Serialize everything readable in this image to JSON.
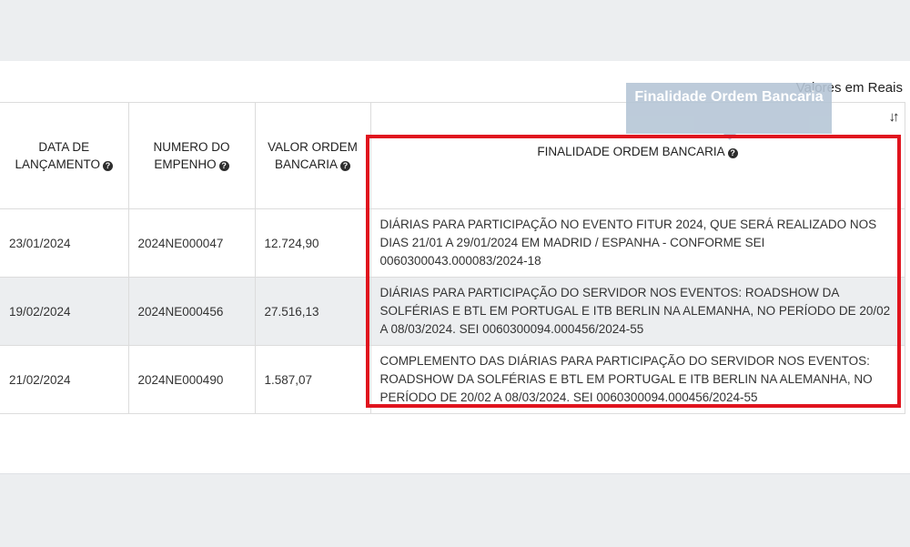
{
  "units_label": "Valores em Reais",
  "tooltip": "Finalidade Ordem Bancaria",
  "columns": [
    {
      "label": "DATA DE LANÇAMENTO"
    },
    {
      "label": "NUMERO DO EMPENHO"
    },
    {
      "label": "VALOR ORDEM BANCARIA"
    },
    {
      "label": "FINALIDADE ORDEM BANCARIA"
    }
  ],
  "rows": [
    {
      "date": "23/01/2024",
      "empenho": "2024NE000047",
      "valor": "12.724,90",
      "finalidade": "DIÁRIAS PARA PARTICIPAÇÃO NO EVENTO FITUR 2024, QUE SERÁ REALIZADO NOS DIAS 21/01 A 29/01/2024 EM MADRID / ESPANHA - CONFORME SEI 0060300043.000083/2024-18"
    },
    {
      "date": "19/02/2024",
      "empenho": "2024NE000456",
      "valor": "27.516,13",
      "finalidade": "DIÁRIAS PARA PARTICIPAÇÃO DO SERVIDOR NOS EVENTOS: ROADSHOW DA SOLFÉRIAS E BTL EM PORTUGAL E ITB BERLIN NA ALEMANHA, NO PERÍODO DE 20/02 A 08/03/2024. SEI 0060300094.000456/2024-55"
    },
    {
      "date": "21/02/2024",
      "empenho": "2024NE000490",
      "valor": "1.587,07",
      "finalidade": "COMPLEMENTO DAS DIÁRIAS PARA PARTICIPAÇÃO DO SERVIDOR NOS EVENTOS: ROADSHOW DA SOLFÉRIAS E BTL EM PORTUGAL E ITB BERLIN NA ALEMANHA, NO PERÍODO DE 20/02 A 08/03/2024. SEI 0060300094.000456/2024-55"
    }
  ],
  "icons": {
    "info": "question-circle-icon",
    "sort": "sort-arrows-icon"
  },
  "colors": {
    "highlight": "#e0141e",
    "tooltip_bg": "#b6c6d6",
    "alt_row": "#eceef0"
  }
}
